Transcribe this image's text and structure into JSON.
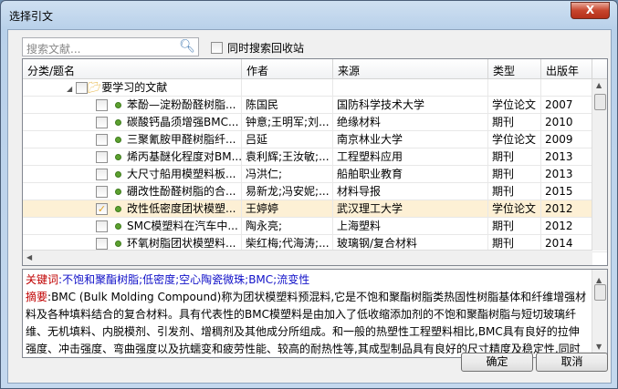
{
  "window": {
    "title": "选择引文",
    "close": "X"
  },
  "search": {
    "placeholder": "搜索文献...",
    "option_label": "同时搜索回收站",
    "option_checked": false
  },
  "table": {
    "columns": [
      "分类/题名",
      "作者",
      "来源",
      "类型",
      "出版年"
    ],
    "folder": "要学习的文献",
    "rows": [
      {
        "title": "苯酚—淀粉酚醛树脂...",
        "author": "陈国民",
        "source": "国防科学技术大学",
        "type": "学位论文",
        "year": "2007",
        "checked": false
      },
      {
        "title": "碳酸钙晶须增强BMC...",
        "author": "钟意;王明军;刘...",
        "source": "绝缘材料",
        "type": "期刊",
        "year": "2010",
        "checked": false
      },
      {
        "title": "三聚氰胺甲醛树脂纤...",
        "author": "吕延",
        "source": "南京林业大学",
        "type": "学位论文",
        "year": "2009",
        "checked": false
      },
      {
        "title": "烯丙基醚化程度对BM...",
        "author": "袁利辉;王汝敏;...",
        "source": "工程塑料应用",
        "type": "期刊",
        "year": "2013",
        "checked": false
      },
      {
        "title": "大尺寸船用模塑料板...",
        "author": "冯洪仁;",
        "source": "船舶职业教育",
        "type": "期刊",
        "year": "2013",
        "checked": false
      },
      {
        "title": "硼改性酚醛树脂的合...",
        "author": "易新龙;冯安妮;...",
        "source": "材料导报",
        "type": "期刊",
        "year": "2015",
        "checked": false
      },
      {
        "title": "改性低密度团状模塑...",
        "author": "王婷婷",
        "source": "武汉理工大学",
        "type": "学位论文",
        "year": "2012",
        "checked": true
      },
      {
        "title": "SMC模塑料在汽车中...",
        "author": "陶永亮;",
        "source": "上海塑料",
        "type": "期刊",
        "year": "2012",
        "checked": false
      },
      {
        "title": "环氧树脂团状模塑料...",
        "author": "柴红梅;代海涛;...",
        "source": "玻璃钢/复合材料",
        "type": "期刊",
        "year": "2014",
        "checked": false
      }
    ]
  },
  "detail": {
    "keywords_label": "关键词",
    "keywords": "不饱和聚酯树脂;低密度;空心陶瓷微珠;BMC;流变性",
    "abstract_label": "摘要",
    "abstract": "BMC (Bulk Molding Compound)称为团状模塑料预混料,它是不饱和聚酯树脂类热固性树脂基体和纤维增强材料及各种填料结合的复合材料。具有代表性的BMC模塑料是由加入了低收缩添加剂的不饱和聚酯树脂与短切玻璃纤维、无机填料、内脱模剂、引发剂、增稠剂及其他成分所组成。和一般的热塑性工程塑料相比,BMC具有良好的拉伸强度、冲击强度、弯曲强度以及抗蠕变和疲劳性能、较高的耐热性等,其成型制品具有良好的尺寸精度及稳定性,同时还可以提高耐蚀性、阻燃性等性能,适用于汽车、电器、航空等多个领域。"
  },
  "buttons": {
    "ok": "确定",
    "cancel": "取消"
  }
}
